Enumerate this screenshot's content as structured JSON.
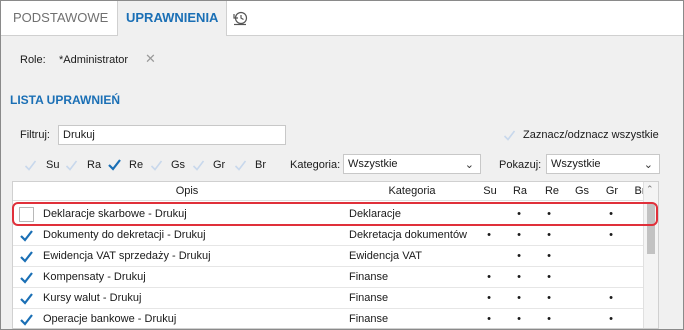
{
  "tabs": [
    {
      "label": "PODSTAWOWE",
      "active": false
    },
    {
      "label": "UPRAWNIENIA",
      "active": true
    }
  ],
  "history_icon": "history-clock-icon",
  "role": {
    "label": "Role:",
    "value": "*Administrator"
  },
  "section_title": "LISTA UPRAWNIEŃ",
  "filter": {
    "label": "Filtruj:",
    "value": "Drukuj"
  },
  "toggle_all_label": "Zaznacz/odznacz wszystkie",
  "permission_toggles": [
    {
      "label": "Su",
      "checked": false
    },
    {
      "label": "Ra",
      "checked": false
    },
    {
      "label": "Re",
      "checked": true
    },
    {
      "label": "Gs",
      "checked": false
    },
    {
      "label": "Gr",
      "checked": false
    },
    {
      "label": "Br",
      "checked": false
    }
  ],
  "category_filter": {
    "label": "Kategoria:",
    "value": "Wszystkie"
  },
  "show_filter": {
    "label": "Pokazuj:",
    "value": "Wszystkie"
  },
  "table": {
    "columns": [
      "Opis",
      "Kategoria",
      "Su",
      "Ra",
      "Re",
      "Gs",
      "Gr",
      "Br"
    ],
    "rows": [
      {
        "checked": false,
        "opis": "Deklaracje skarbowe - Drukuj",
        "kategoria": "Deklaracje",
        "su": "",
        "ra": "•",
        "re": "•",
        "gs": "",
        "gr": "•",
        "br": "",
        "highlighted": true
      },
      {
        "checked": true,
        "opis": "Dokumenty do dekretacji - Drukuj",
        "kategoria": "Dekretacja dokumentów",
        "su": "•",
        "ra": "•",
        "re": "•",
        "gs": "",
        "gr": "•",
        "br": ""
      },
      {
        "checked": true,
        "opis": "Ewidencja VAT sprzedaży - Drukuj",
        "kategoria": "Ewidencja VAT",
        "su": "",
        "ra": "•",
        "re": "•",
        "gs": "",
        "gr": "",
        "br": ""
      },
      {
        "checked": true,
        "opis": "Kompensaty - Drukuj",
        "kategoria": "Finanse",
        "su": "•",
        "ra": "•",
        "re": "•",
        "gs": "",
        "gr": "",
        "br": ""
      },
      {
        "checked": true,
        "opis": "Kursy walut - Drukuj",
        "kategoria": "Finanse",
        "su": "•",
        "ra": "•",
        "re": "•",
        "gs": "",
        "gr": "•",
        "br": ""
      },
      {
        "checked": true,
        "opis": "Operacje bankowe - Drukuj",
        "kategoria": "Finanse",
        "su": "•",
        "ra": "•",
        "re": "•",
        "gs": "",
        "gr": "•",
        "br": ""
      }
    ]
  },
  "colors": {
    "accent": "#1a6fb5",
    "highlight": "#e0303a"
  }
}
